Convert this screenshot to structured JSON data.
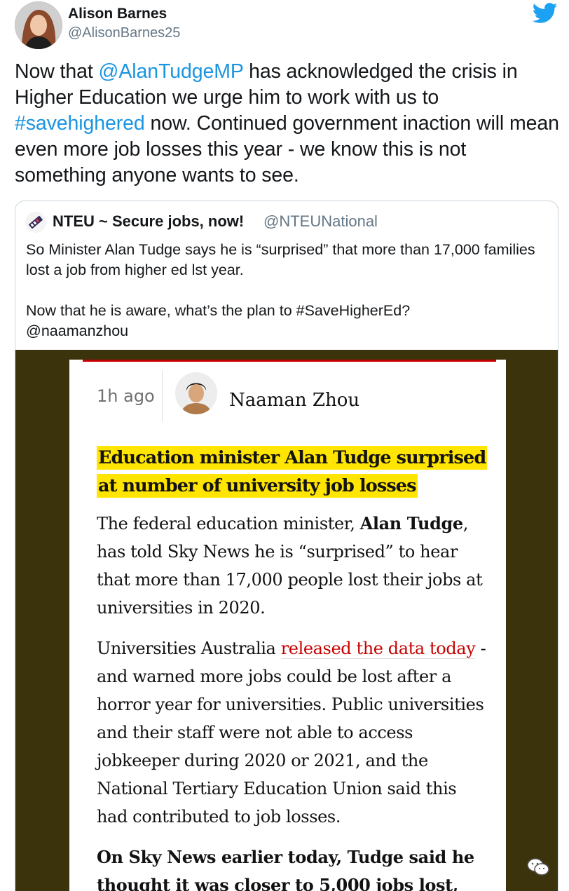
{
  "author": {
    "name": "Alison Barnes",
    "handle": "@AlisonBarnes25"
  },
  "tweet": {
    "part1": "Now that ",
    "mention": "@AlanTudgeMP",
    "part2": " has acknowledged the crisis in Higher Education we urge him to work with us to ",
    "hashtag": "#savehighered",
    "part3": " now. Continued government inaction will mean even more job losses this year - we know this is not something anyone wants to see."
  },
  "quoted": {
    "name": "NTEU ~ Secure jobs, now!",
    "handle": "@NTEUNational",
    "line1": "So Minister Alan Tudge says he is “surprised” that more than 17,000 families lost a job from higher ed lst year.",
    "line2": "Now that he is aware, what’s the plan to #SaveHigherEd?",
    "line3": "@naamanzhou"
  },
  "article": {
    "timestamp": "1h ago",
    "author_name": "Naaman Zhou",
    "headline": "Education minister Alan Tudge surprised at number of university job losses",
    "p1_a": "The federal education minister, ",
    "p1_bold": "Alan Tudge",
    "p1_b": ", has told Sky News he is “surprised” to hear that more than 17,000 people lost their jobs at universities in 2020.",
    "p2_a": "Universities Australia ",
    "p2_link": "released the data today",
    "p2_b": " - and warned more jobs could be lost after a horror year for universities. Public universities and their staff were not able to access jobkeeper during 2020 or 2021, and the National Tertiary Education Union said this had contributed to job losses.",
    "p3": "On Sky News earlier today, Tudge said he thought it was closer to 5,000 jobs lost,"
  },
  "colors": {
    "link_blue": "#1b95e0",
    "twitter_blue": "#1da1f2",
    "highlight_yellow": "#ffe500",
    "guardian_red": "#c70000",
    "media_bg": "#3a330b"
  },
  "icons": {
    "brand": "twitter-bird-icon",
    "badge": "wechat-icon"
  }
}
